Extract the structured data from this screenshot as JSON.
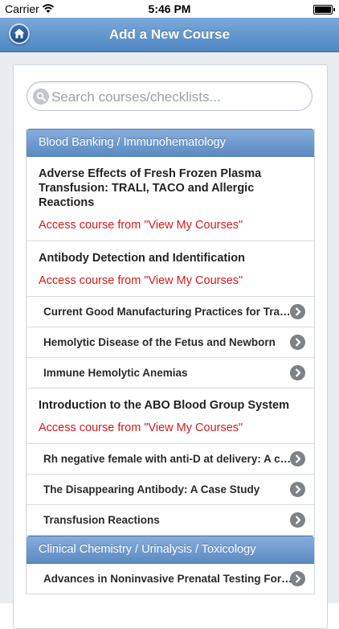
{
  "status": {
    "carrier": "Carrier",
    "time": "5:46 PM"
  },
  "nav": {
    "title": "Add a New Course"
  },
  "search": {
    "placeholder": "Search courses/checklists..."
  },
  "categories": [
    {
      "name": "Blood Banking / Immunohematology",
      "items": [
        {
          "type": "big",
          "title": "Adverse Effects of Fresh Frozen Plasma Transfusion: TRALI, TACO and Allergic Reactions",
          "access": "Access course from \"View My Courses\""
        },
        {
          "type": "big",
          "title": "Antibody Detection and Identification",
          "access": "Access course from \"View My Courses\""
        },
        {
          "type": "small",
          "title": "Current Good Manufacturing Practices for Transfusion"
        },
        {
          "type": "small",
          "title": "Hemolytic Disease of the Fetus and Newborn"
        },
        {
          "type": "small",
          "title": "Immune Hemolytic Anemias"
        },
        {
          "type": "big",
          "title": "Introduction to the ABO Blood Group System",
          "access": "Access course from \"View My Courses\""
        },
        {
          "type": "small",
          "title": "Rh negative female with anti-D at delivery: A case study"
        },
        {
          "type": "small",
          "title": "The Disappearing Antibody: A Case Study"
        },
        {
          "type": "small",
          "title": "Transfusion Reactions"
        }
      ]
    },
    {
      "name": "Clinical Chemistry / Urinalysis / Toxicology",
      "items": [
        {
          "type": "small",
          "title": "Advances in Noninvasive Prenatal Testing For Aneuploidy"
        }
      ]
    }
  ]
}
